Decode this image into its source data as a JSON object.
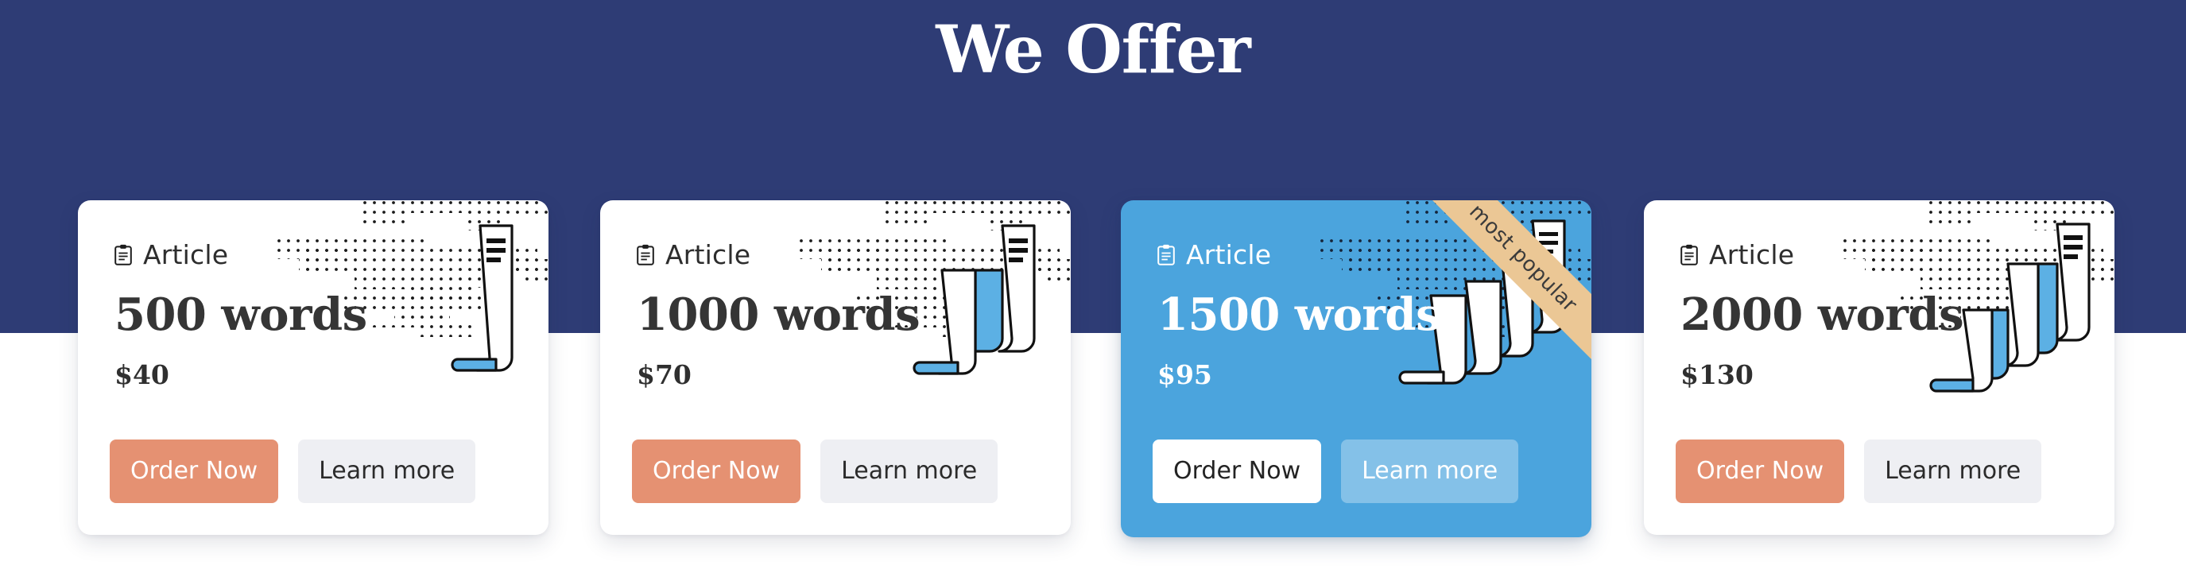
{
  "hero": {
    "title": "We Offer",
    "background_color": "#2e3c75"
  },
  "theme": {
    "navy": "#2e3c75",
    "accent_orange": "#e59172",
    "accent_blue": "#4ba4dd",
    "neutral_button": "#eeeff3",
    "ribbon_tan": "#ebc795"
  },
  "icons": {
    "clipboard": "clipboard-icon"
  },
  "cards": [
    {
      "category": "Article",
      "words": "500 words",
      "price": "$40",
      "order_label": "Order Now",
      "learn_label": "Learn more",
      "featured": false,
      "ribbon": "",
      "scrolls": 1
    },
    {
      "category": "Article",
      "words": "1000 words",
      "price": "$70",
      "order_label": "Order Now",
      "learn_label": "Learn more",
      "featured": false,
      "ribbon": "",
      "scrolls": 2
    },
    {
      "category": "Article",
      "words": "1500 words",
      "price": "$95",
      "order_label": "Order Now",
      "learn_label": "Learn more",
      "featured": true,
      "ribbon": "most popular",
      "scrolls": 3
    },
    {
      "category": "Article",
      "words": "2000 words",
      "price": "$130",
      "order_label": "Order Now",
      "learn_label": "Learn more",
      "featured": false,
      "ribbon": "",
      "scrolls": 3
    }
  ]
}
